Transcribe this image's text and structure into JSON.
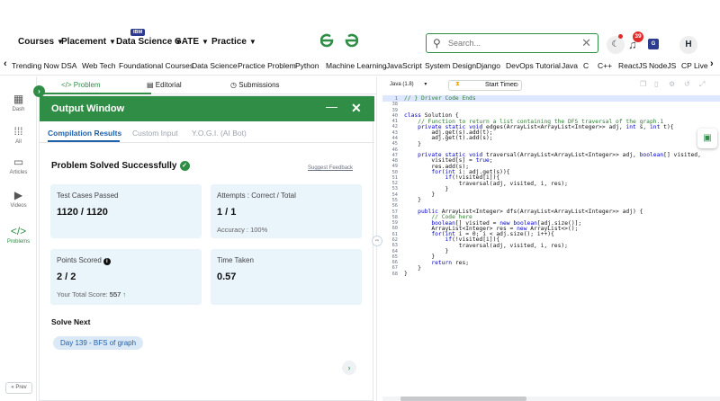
{
  "topnav": {
    "items": [
      "Courses",
      "Placement",
      "Data Science",
      "GATE",
      "Practice"
    ],
    "ibm_badge": "IBM",
    "logo": "GfG",
    "search_placeholder": "Search...",
    "notification_count": "39",
    "profile_initial": "H"
  },
  "subnav": {
    "items": [
      "Trending Now",
      "DSA",
      "Web Tech",
      "Foundational Courses",
      "Data Science",
      "Practice Problem",
      "Python",
      "Machine Learning",
      "JavaScript",
      "System Design",
      "Django",
      "DevOps Tutorial",
      "Java",
      "C",
      "C++",
      "ReactJS",
      "NodeJS",
      "CP Live"
    ]
  },
  "leftrail": {
    "items": [
      {
        "label": "Dash",
        "icon": "dashboard-icon"
      },
      {
        "label": "All",
        "icon": "grid-icon"
      },
      {
        "label": "Articles",
        "icon": "articles-icon"
      },
      {
        "label": "Videos",
        "icon": "video-icon"
      },
      {
        "label": "Problems",
        "icon": "code-icon"
      }
    ],
    "prev_label": "« Prev"
  },
  "problem_tabs": [
    "</> Problem",
    "Editorial",
    "Submissions"
  ],
  "output_window": {
    "title": "Output Window",
    "tabs": [
      "Compilation Results",
      "Custom Input",
      "Y.O.G.I. (AI Bot)"
    ],
    "status": "Problem Solved Successfully",
    "feedback_link": "Suggest Feedback",
    "cards": [
      {
        "label": "Test Cases Passed",
        "value": "1120 / 1120",
        "sub": ""
      },
      {
        "label": "Attempts : Correct / Total",
        "value": "1 / 1",
        "sub": "Accuracy : 100%"
      },
      {
        "label": "Points Scored",
        "value": "2 / 2",
        "sub_prefix": "Your Total Score: ",
        "sub_value": "557"
      },
      {
        "label": "Time Taken",
        "value": "0.57",
        "sub": ""
      }
    ],
    "solve_next_title": "Solve Next",
    "solve_next_item": "Day 139 - BFS of graph"
  },
  "editor": {
    "language": "Java (1.8)",
    "timer_label": "Start Timer",
    "lines": [
      {
        "n": "1",
        "text": "// } Driver Code Ends"
      },
      {
        "n": "38",
        "text": ""
      },
      {
        "n": "39",
        "text": ""
      },
      {
        "n": "40",
        "text": "class Solution {"
      },
      {
        "n": "41",
        "text": "    // Function to return a list containing the DFS traversal of the graph.1"
      },
      {
        "n": "42",
        "text": "    private static void edges(ArrayList<ArrayList<Integer>> adj, int s, int t){"
      },
      {
        "n": "43",
        "text": "        adj.get(s).add(t);"
      },
      {
        "n": "44",
        "text": "        adj.get(t).add(s);"
      },
      {
        "n": "45",
        "text": "    }"
      },
      {
        "n": "46",
        "text": ""
      },
      {
        "n": "47",
        "text": "    private static void traversal(ArrayList<ArrayList<Integer>> adj, boolean[] visited,"
      },
      {
        "n": "48",
        "text": "        visited[s] = true;"
      },
      {
        "n": "49",
        "text": "        res.add(s);"
      },
      {
        "n": "50",
        "text": "        for(int i: adj.get(s)){"
      },
      {
        "n": "51",
        "text": "            if(!visited[i]){"
      },
      {
        "n": "52",
        "text": "                traversal(adj, visited, i, res);"
      },
      {
        "n": "53",
        "text": "            }"
      },
      {
        "n": "54",
        "text": "        }"
      },
      {
        "n": "55",
        "text": "    }"
      },
      {
        "n": "56",
        "text": ""
      },
      {
        "n": "57",
        "text": "    public ArrayList<Integer> dfs(ArrayList<ArrayList<Integer>> adj) {"
      },
      {
        "n": "58",
        "text": "        // Code here"
      },
      {
        "n": "59",
        "text": "        boolean[] visited = new boolean[adj.size()];"
      },
      {
        "n": "60",
        "text": "        ArrayList<Integer> res = new ArrayList<>();"
      },
      {
        "n": "61",
        "text": "        for(int i = 0; i < adj.size(); i++){"
      },
      {
        "n": "62",
        "text": "            if(!visited[i]){"
      },
      {
        "n": "63",
        "text": "                traversal(adj, visited, i, res);"
      },
      {
        "n": "64",
        "text": "            }"
      },
      {
        "n": "65",
        "text": "        }"
      },
      {
        "n": "66",
        "text": "        return res;"
      },
      {
        "n": "67",
        "text": "    }"
      },
      {
        "n": "68",
        "text": "}"
      }
    ]
  },
  "colors": {
    "brand_green": "#2f8d46",
    "link_blue": "#1f5fa8",
    "card_bg": "#eaf4fb"
  }
}
